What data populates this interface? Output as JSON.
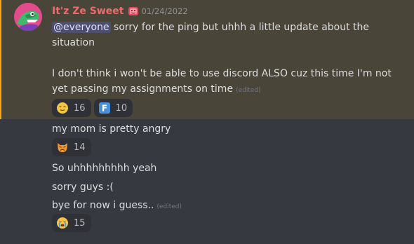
{
  "author": {
    "name": "It'z Ze Sweet",
    "timestamp": "01/24/2022",
    "name_color": "#f26a6a"
  },
  "messages": {
    "m1": {
      "mention": "@everyone",
      "line1_rest": " sorry for the ping but uhhh a little update about the",
      "line2": "situation",
      "line3": "I don't think i won't be able to use discord ALSO cuz this time I'm not",
      "line4": "yet passing my assignments on time",
      "edited": "(edited)",
      "reactions": [
        {
          "emoji": "relieved-face",
          "count": "16"
        },
        {
          "emoji": "regional-f",
          "letter": "F",
          "count": "10"
        }
      ]
    },
    "m2": {
      "text": "my mom is pretty angry",
      "reactions": [
        {
          "emoji": "angry-cat",
          "count": "14"
        }
      ]
    },
    "m3": {
      "text": "So uhhhhhhhhh yeah"
    },
    "m4": {
      "text": "sorry guys :("
    },
    "m5": {
      "text": "bye for now i guess..",
      "edited": "(edited)",
      "reactions": [
        {
          "emoji": "crying-face",
          "count": "15"
        }
      ]
    }
  },
  "colors": {
    "background": "#36393f",
    "highlight": "#494538",
    "highlight_bar": "#faa61a",
    "reaction_bg": "#2f3136"
  }
}
